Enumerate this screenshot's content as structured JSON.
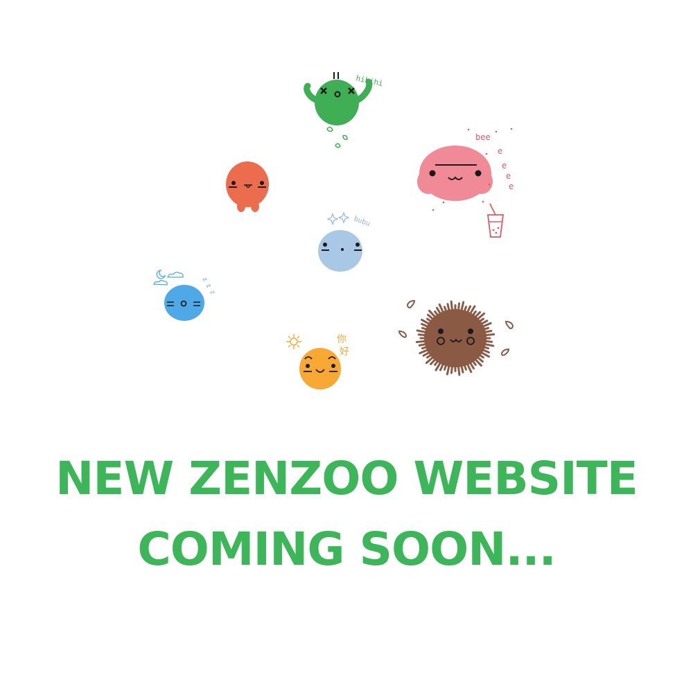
{
  "colors": {
    "headline": "#3db65a",
    "green_critter": "#3fae55",
    "red_critter": "#ec6c4e",
    "pink_critter": "#f08a96",
    "lightblue_critter": "#a9c8e6",
    "blue_critter": "#4fa9e6",
    "orange_critter": "#f7a933",
    "brown_critter": "#8a5a45",
    "face": "#1a1a1a"
  },
  "critters": [
    {
      "name": "green-critter-icon",
      "sound": "hihihi",
      "color_key": "green_critter"
    },
    {
      "name": "red-critter-icon",
      "sound": "",
      "color_key": "red_critter"
    },
    {
      "name": "pink-critter-icon",
      "sound": "bee",
      "sound2": "e",
      "color_key": "pink_critter"
    },
    {
      "name": "lightblue-critter-icon",
      "sound": "bubu",
      "color_key": "lightblue_critter"
    },
    {
      "name": "blue-critter-icon",
      "sound": "z z z",
      "color_key": "blue_critter"
    },
    {
      "name": "orange-critter-icon",
      "sound": "你",
      "sound2": "好",
      "color_key": "orange_critter"
    },
    {
      "name": "brown-critter-icon",
      "sound": "",
      "color_key": "brown_critter"
    }
  ],
  "headline": {
    "line1": "NEW ZENZOO WEBSITE",
    "line2": "COMING SOON..."
  }
}
